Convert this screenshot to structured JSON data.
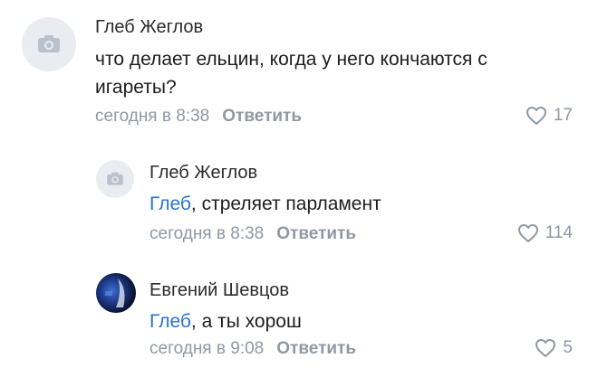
{
  "comments": [
    {
      "author": "Глеб Жеглов",
      "mention": "",
      "text_line1": "что делает ельцин, когда у него кончаются с",
      "text_line2": "игареты?",
      "date": "сегодня в 8:38",
      "reply_label": "Ответить",
      "likes": "17",
      "avatar_icon": "camera-icon"
    },
    {
      "author": "Глеб Жеглов",
      "mention": "Глеб",
      "text": ", стреляет парламент",
      "date": "сегодня в 8:38",
      "reply_label": "Ответить",
      "likes": "114",
      "avatar_icon": "camera-icon"
    },
    {
      "author": "Евгений Шевцов",
      "mention": "Глеб",
      "text": ", а ты хорош",
      "date": "сегодня в 9:08",
      "reply_label": "Ответить",
      "likes": "5",
      "avatar_icon": "user-photo"
    }
  ],
  "colors": {
    "mention": "#2a73c9",
    "meta": "#8f98a3",
    "avatar_placeholder": "#e9edf2"
  }
}
